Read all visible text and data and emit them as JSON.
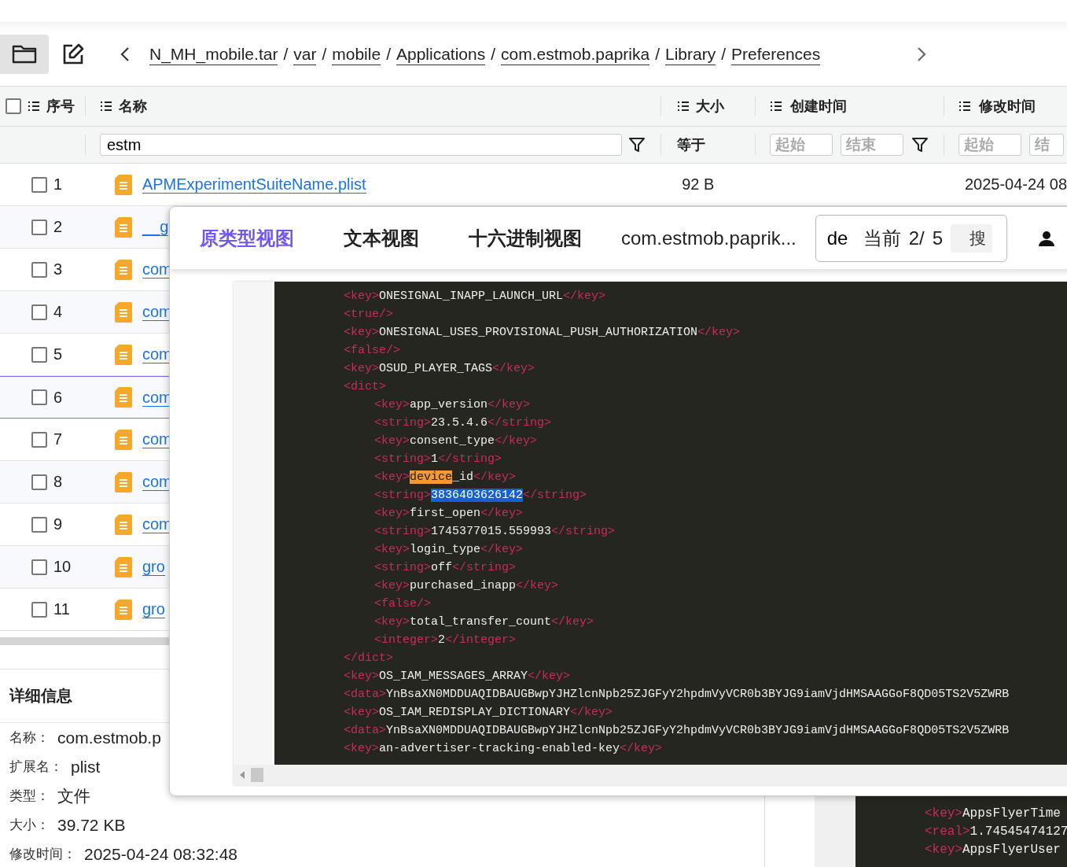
{
  "toolbar": {
    "breadcrumb": [
      {
        "label": "N_MH_mobile.tar"
      },
      {
        "sep": "/",
        "label": "var"
      },
      {
        "sep": "/",
        "label": "mobile"
      },
      {
        "sep": "/",
        "label": "Applications"
      },
      {
        "sep": "/",
        "label": "com.estmob.paprika"
      },
      {
        "sep": "/",
        "label": "Library"
      },
      {
        "sep": "/",
        "label": "Preferences"
      }
    ]
  },
  "table": {
    "select_all": {
      "checked": false
    },
    "columns": [
      {
        "label": "序号"
      },
      {
        "label": "名称"
      },
      {
        "label": "大小"
      },
      {
        "label": "创建时间"
      },
      {
        "label": "修改时间"
      }
    ],
    "filters": {
      "name_value": "estm",
      "size_operator": "等于",
      "created_range": [
        {
          "placeholder": "起始"
        },
        {
          "placeholder": "结束"
        }
      ],
      "modified_range": [
        {
          "placeholder": "起始"
        },
        {
          "placeholder": "结"
        }
      ]
    },
    "rows": [
      {
        "index": "1",
        "name": "APMExperimentSuiteName.plist",
        "size": "92 B",
        "modified": "2025-04-24 08",
        "checked": false,
        "selected": false
      },
      {
        "index": "2",
        "name": "__g",
        "checked": false,
        "selected": false
      },
      {
        "index": "3",
        "name": "com",
        "checked": false,
        "selected": false
      },
      {
        "index": "4",
        "name": "com",
        "checked": false,
        "selected": false
      },
      {
        "index": "5",
        "name": "com",
        "checked": false,
        "selected": false
      },
      {
        "index": "6",
        "name": "com",
        "checked": false,
        "selected": true
      },
      {
        "index": "7",
        "name": "com",
        "checked": false,
        "selected": false
      },
      {
        "index": "8",
        "name": "com",
        "checked": false,
        "selected": false
      },
      {
        "index": "9",
        "name": "com",
        "checked": false,
        "selected": false
      },
      {
        "index": "10",
        "name": "gro",
        "checked": false,
        "selected": false
      },
      {
        "index": "11",
        "name": "gro",
        "checked": false,
        "selected": false
      }
    ]
  },
  "details": {
    "title": "详细信息",
    "fields": [
      {
        "label": "名称：",
        "value": "com.estmob.p"
      },
      {
        "label": "扩展名：",
        "value": "plist"
      },
      {
        "label": "类型：",
        "value": "文件"
      },
      {
        "label": "大小：",
        "value": "39.72 KB"
      },
      {
        "label": "修改时间：",
        "value": "2025-04-24 08:32:48"
      }
    ]
  },
  "background_code": {
    "lines": [
      [
        {
          "kind": "tag",
          "text": "<key>"
        },
        {
          "kind": "text",
          "text": "AppsFlyerTime"
        }
      ],
      [
        {
          "kind": "tag",
          "text": "<real>"
        },
        {
          "kind": "text",
          "text": "1.74545474127"
        }
      ],
      [
        {
          "kind": "tag",
          "text": "<key>"
        },
        {
          "kind": "text",
          "text": "AppsFlyerUser"
        }
      ]
    ]
  },
  "viewer": {
    "tabs": [
      {
        "label": "原类型视图",
        "selected": true
      },
      {
        "label": "文本视图",
        "selected": false
      },
      {
        "label": "十六进制视图",
        "selected": false
      }
    ],
    "file_name": "com.estmob.paprik...",
    "search": {
      "value": "de",
      "current_label": "当前",
      "position": "2/",
      "total": "5",
      "button": "搜"
    },
    "code": [
      {
        "segments": [
          {
            "kind": "tag",
            "text": "<key>"
          },
          {
            "kind": "text",
            "text": "ONESIGNAL_INAPP_LAUNCH_URL"
          },
          {
            "kind": "tag",
            "text": "</key>"
          }
        ]
      },
      {
        "segments": [
          {
            "kind": "tag",
            "text": "<true/>"
          }
        ]
      },
      {
        "segments": [
          {
            "kind": "tag",
            "text": "<key>"
          },
          {
            "kind": "text",
            "text": "ONESIGNAL_USES_PROVISIONAL_PUSH_AUTHORIZATION"
          },
          {
            "kind": "tag",
            "text": "</key>"
          }
        ]
      },
      {
        "segments": [
          {
            "kind": "tag",
            "text": "<false/>"
          }
        ]
      },
      {
        "segments": [
          {
            "kind": "tag",
            "text": "<key>"
          },
          {
            "kind": "text",
            "text": "OSUD_PLAYER_TAGS"
          },
          {
            "kind": "tag",
            "text": "</key>"
          }
        ]
      },
      {
        "segments": [
          {
            "kind": "tag",
            "text": "<dict>"
          }
        ],
        "children": [
          {
            "segments": [
              {
                "kind": "tag",
                "text": "<key>"
              },
              {
                "kind": "text",
                "text": "app_version"
              },
              {
                "kind": "tag",
                "text": "</key>"
              }
            ]
          },
          {
            "segments": [
              {
                "kind": "tag",
                "text": "<string>"
              },
              {
                "kind": "text",
                "text": "23.5.4.6"
              },
              {
                "kind": "tag",
                "text": "</string>"
              }
            ]
          },
          {
            "segments": [
              {
                "kind": "tag",
                "text": "<key>"
              },
              {
                "kind": "text",
                "text": "consent_type"
              },
              {
                "kind": "tag",
                "text": "</key>"
              }
            ]
          },
          {
            "segments": [
              {
                "kind": "tag",
                "text": "<string>"
              },
              {
                "kind": "text",
                "text": "1"
              },
              {
                "kind": "tag",
                "text": "</string>"
              }
            ]
          },
          {
            "segments": [
              {
                "kind": "tag",
                "text": "<key>"
              },
              {
                "kind": "match",
                "text": "device"
              },
              {
                "kind": "text",
                "text": "_id"
              },
              {
                "kind": "tag",
                "text": "</key>"
              }
            ]
          },
          {
            "segments": [
              {
                "kind": "tag",
                "text": "<string>"
              },
              {
                "kind": "selection",
                "text": "3836403626142"
              },
              {
                "kind": "tag",
                "text": "</string>"
              }
            ]
          },
          {
            "segments": [
              {
                "kind": "tag",
                "text": "<key>"
              },
              {
                "kind": "text",
                "text": "first_open"
              },
              {
                "kind": "tag",
                "text": "</key>"
              }
            ]
          },
          {
            "segments": [
              {
                "kind": "tag",
                "text": "<string>"
              },
              {
                "kind": "text",
                "text": "1745377015.559993"
              },
              {
                "kind": "tag",
                "text": "</string>"
              }
            ]
          },
          {
            "segments": [
              {
                "kind": "tag",
                "text": "<key>"
              },
              {
                "kind": "text",
                "text": "login_type"
              },
              {
                "kind": "tag",
                "text": "</key>"
              }
            ]
          },
          {
            "segments": [
              {
                "kind": "tag",
                "text": "<string>"
              },
              {
                "kind": "text",
                "text": "off"
              },
              {
                "kind": "tag",
                "text": "</string>"
              }
            ]
          },
          {
            "segments": [
              {
                "kind": "tag",
                "text": "<key>"
              },
              {
                "kind": "text",
                "text": "purchased_inapp"
              },
              {
                "kind": "tag",
                "text": "</key>"
              }
            ]
          },
          {
            "segments": [
              {
                "kind": "tag",
                "text": "<false/>"
              }
            ]
          },
          {
            "segments": [
              {
                "kind": "tag",
                "text": "<key>"
              },
              {
                "kind": "text",
                "text": "total_transfer_count"
              },
              {
                "kind": "tag",
                "text": "</key>"
              }
            ]
          },
          {
            "segments": [
              {
                "kind": "tag",
                "text": "<integer>"
              },
              {
                "kind": "text",
                "text": "2"
              },
              {
                "kind": "tag",
                "text": "</integer>"
              }
            ]
          }
        ]
      },
      {
        "segments": [
          {
            "kind": "tag",
            "text": "</dict>"
          }
        ]
      },
      {
        "segments": [
          {
            "kind": "tag",
            "text": "<key>"
          },
          {
            "kind": "text",
            "text": "OS_IAM_MESSAGES_ARRAY"
          },
          {
            "kind": "tag",
            "text": "</key>"
          }
        ]
      },
      {
        "segments": [
          {
            "kind": "tag",
            "text": "<data>"
          },
          {
            "kind": "text",
            "text": "YnBsaXN0MDDUAQIDBAUGBwpYJHZlcnNpb25ZJGFyY2hpdmVyVCR0b3BYJG9iamVjdHMSAAGGoF8QD05TS2V5ZWRB"
          }
        ]
      },
      {
        "segments": [
          {
            "kind": "tag",
            "text": "<key>"
          },
          {
            "kind": "text",
            "text": "OS_IAM_REDISPLAY_DICTIONARY"
          },
          {
            "kind": "tag",
            "text": "</key>"
          }
        ]
      },
      {
        "segments": [
          {
            "kind": "tag",
            "text": "<data>"
          },
          {
            "kind": "text",
            "text": "YnBsaXN0MDDUAQIDBAUGBwpYJHZlcnNpb25ZJGFyY2hpdmVyVCR0b3BYJG9iamVjdHMSAAGGoF8QD05TS2V5ZWRB"
          }
        ]
      },
      {
        "segments": [
          {
            "kind": "tag",
            "text": "<key>"
          },
          {
            "kind": "text",
            "text": "an-advertiser-tracking-enabled-key"
          },
          {
            "kind": "tag",
            "text": "</key>"
          }
        ]
      }
    ]
  }
}
